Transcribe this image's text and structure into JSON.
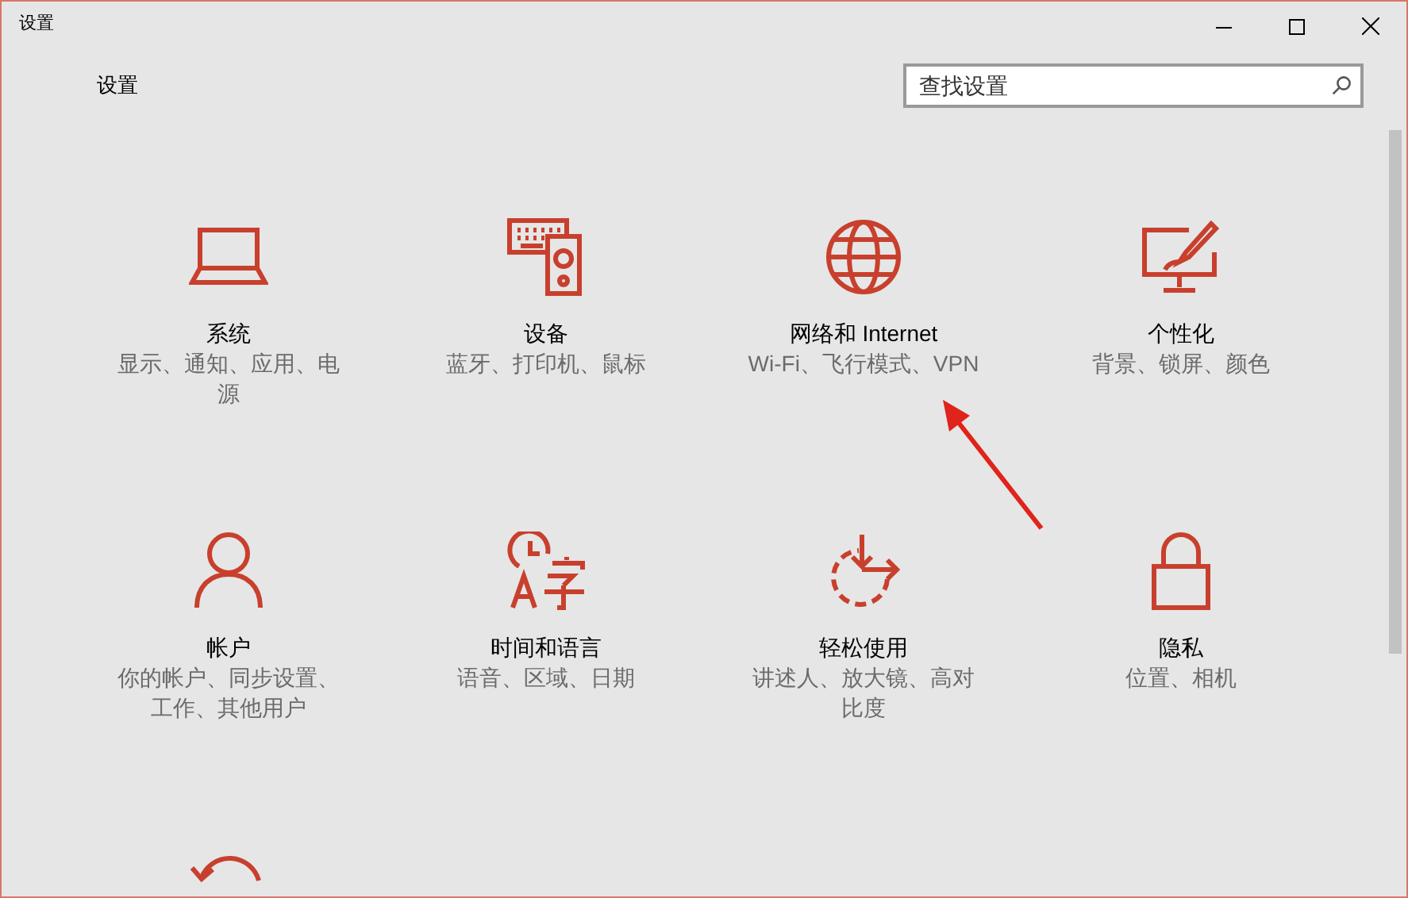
{
  "window": {
    "title": "设置"
  },
  "header": {
    "title": "设置",
    "search": {
      "placeholder": "查找设置"
    }
  },
  "tiles": [
    {
      "title": "系统",
      "description": "显示、通知、应用、电源"
    },
    {
      "title": "设备",
      "description": "蓝牙、打印机、鼠标"
    },
    {
      "title": "网络和 Internet",
      "description": "Wi-Fi、飞行模式、VPN"
    },
    {
      "title": "个性化",
      "description": "背景、锁屏、颜色"
    },
    {
      "title": "帐户",
      "description": "你的帐户、同步设置、工作、其他用户"
    },
    {
      "title": "时间和语言",
      "description": "语音、区域、日期"
    },
    {
      "title": "轻松使用",
      "description": "讲述人、放大镜、高对比度"
    },
    {
      "title": "隐私",
      "description": "位置、相机"
    }
  ]
}
